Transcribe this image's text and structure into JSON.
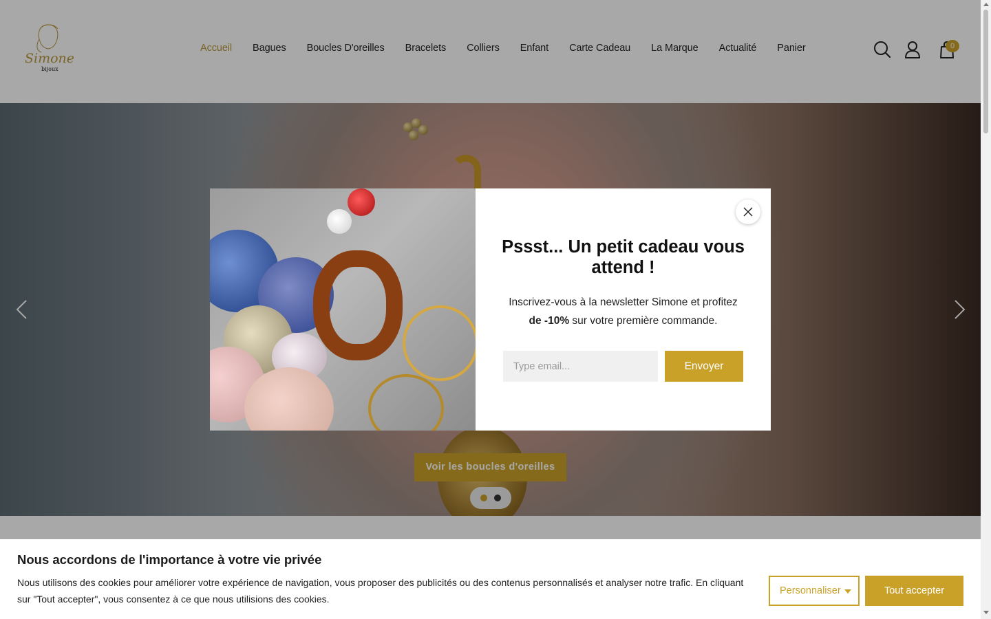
{
  "header": {
    "logo_name": "Simone",
    "logo_sub": "bijoux",
    "nav": [
      {
        "label": "Accueil",
        "active": true
      },
      {
        "label": "Bagues"
      },
      {
        "label": "Boucles D'oreilles"
      },
      {
        "label": "Bracelets"
      },
      {
        "label": "Colliers"
      },
      {
        "label": "Enfant"
      },
      {
        "label": "Carte Cadeau"
      },
      {
        "label": "La Marque"
      },
      {
        "label": "Actualité"
      },
      {
        "label": "Panier"
      }
    ],
    "icons": [
      "search-icon",
      "user-icon",
      "cart-icon"
    ],
    "cart_count": "0"
  },
  "hero": {
    "cta_label": "Voir les boucles d'oreilles",
    "slides_total": 2,
    "active_slide": 1
  },
  "popup": {
    "title": "Pssst... Un petit cadeau vous attend !",
    "text_before": "Inscrivez-vous à la newsletter Simone et profitez",
    "text_bold": "de -10%",
    "text_after": "sur votre première commande.",
    "email_placeholder": "Type email...",
    "submit_label": "Envoyer"
  },
  "cookie": {
    "title": "Nous accordons de l'importance à votre vie privée",
    "text": "Nous utilisons des cookies pour améliorer votre expérience de navigation, vous proposer des publicités ou des contenus personnalisés et analyser notre trafic. En cliquant sur \"Tout accepter\", vous consentez à ce que nous utilisions des cookies.",
    "customize_label": "Personnaliser",
    "accept_label": "Tout accepter"
  },
  "colors": {
    "accent": "#c9a128",
    "active_nav": "#b8963a",
    "overlay": "rgba(0,0,0,0.34)"
  }
}
